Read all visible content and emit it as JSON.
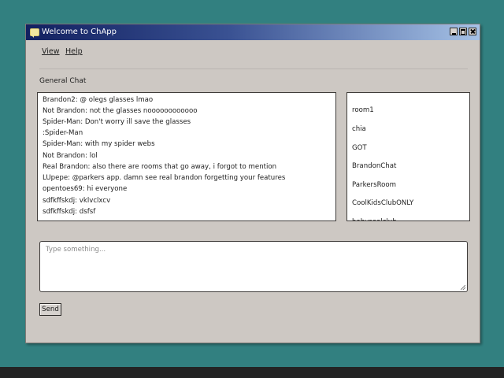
{
  "window": {
    "title": "Welcome to ChApp"
  },
  "menu": {
    "items": [
      {
        "label": "View"
      },
      {
        "label": "Help"
      }
    ]
  },
  "chat": {
    "label": "General Chat",
    "messages": [
      {
        "text": "Brandon2: @ olegs glasses lmao"
      },
      {
        "text": "Not Brandon: not the glasses noooooooooooo"
      },
      {
        "text": "Spider-Man: Don't worry ill save the glasses"
      },
      {
        "text": ":Spider-Man"
      },
      {
        "text": "Spider-Man: with my spider webs"
      },
      {
        "text": "Not Brandon: lol"
      },
      {
        "text": "Real Brandon: also there are rooms that go away, i forgot to mention"
      },
      {
        "text": "LUpepe: @parkers app. damn see real brandon forgetting your features"
      },
      {
        "text": "opentoes69: hi everyone"
      },
      {
        "text": "sdfkffskdj: vklvclxcv"
      },
      {
        "text": "sdfkffskdj: dsfsf"
      }
    ]
  },
  "rooms": [
    {
      "name": "room1"
    },
    {
      "name": "chia"
    },
    {
      "name": "GOT"
    },
    {
      "name": "BrandonChat"
    },
    {
      "name": "ParkersRoom"
    },
    {
      "name": "CoolKidsClubONLY"
    },
    {
      "name": "babysealclub"
    }
  ],
  "composer": {
    "placeholder": "Type something...",
    "value": ""
  },
  "send": {
    "label": "Send"
  }
}
